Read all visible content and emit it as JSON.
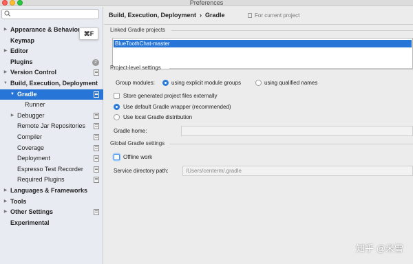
{
  "window": {
    "title": "Preferences"
  },
  "search": {
    "placeholder": "",
    "shortcut_hint": "⌘F",
    "icon": "search-icon"
  },
  "sidebar": {
    "items": [
      {
        "label": "Appearance & Behavior",
        "bold": true,
        "arrow": "▶"
      },
      {
        "label": "Keymap",
        "bold": true
      },
      {
        "label": "Editor",
        "bold": true,
        "arrow": "▶"
      },
      {
        "label": "Plugins",
        "bold": true,
        "badge": "2"
      },
      {
        "label": "Version Control",
        "bold": true,
        "arrow": "▶"
      },
      {
        "label": "Build, Execution, Deployment",
        "bold": true,
        "arrow": "▼"
      },
      {
        "label": "Gradle",
        "bold": true,
        "arrow": "▼",
        "selected": true
      },
      {
        "label": "Runner"
      },
      {
        "label": "Debugger",
        "arrow": "▶"
      },
      {
        "label": "Remote Jar Repositories"
      },
      {
        "label": "Compiler"
      },
      {
        "label": "Coverage"
      },
      {
        "label": "Deployment"
      },
      {
        "label": "Espresso Test Recorder"
      },
      {
        "label": "Required Plugins"
      },
      {
        "label": "Languages & Frameworks",
        "bold": true,
        "arrow": "▶"
      },
      {
        "label": "Tools",
        "bold": true,
        "arrow": "▶"
      },
      {
        "label": "Other Settings",
        "bold": true,
        "arrow": "▶"
      },
      {
        "label": "Experimental",
        "bold": true
      }
    ]
  },
  "header": {
    "breadcrumb_parent": "Build, Execution, Deployment",
    "separator": "›",
    "breadcrumb_current": "Gradle",
    "scope_note": "For current project"
  },
  "linked": {
    "section_title": "Linked Gradle projects",
    "projects": [
      "BlueToothChat-master"
    ]
  },
  "project_level": {
    "section_title": "Project-level settings",
    "group_modules_label": "Group modules:",
    "option_explicit": "using explicit module groups",
    "option_qualified": "using qualified names",
    "store_externally": "Store generated project files externally",
    "use_default_wrapper": "Use default Gradle wrapper (recommended)",
    "use_local": "Use local Gradle distribution",
    "gradle_home_label": "Gradle home:",
    "gradle_home_value": ""
  },
  "global": {
    "section_title": "Global Gradle settings",
    "offline_work": "Offline work",
    "service_dir_label": "Service directory path:",
    "service_dir_value": "/Users/centerm/.gradle"
  },
  "watermark": "知乎 @米雪",
  "colors": {
    "selection": "#2675d7",
    "sidebar_bg": "#e8ecf2",
    "panel_bg": "#ececec"
  }
}
